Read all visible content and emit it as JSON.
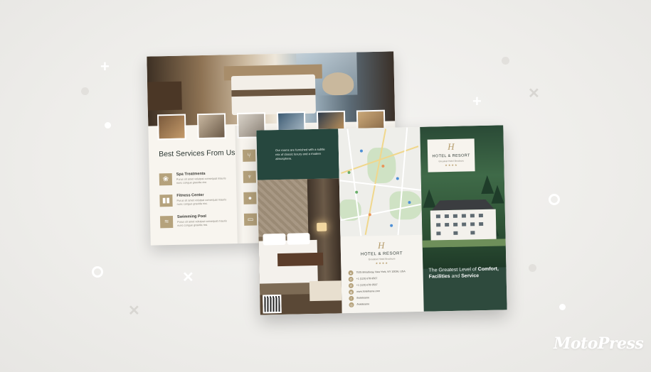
{
  "back_brochure": {
    "heading": "Best Services From Us",
    "services": [
      {
        "name": "Spa Treatments",
        "desc": "Purus sit amet volutpat consequat mauris nunc congue gravida nisi.",
        "icon": "spa-icon"
      },
      {
        "name": "Fitness Center",
        "desc": "Purus sit amet volutpat consequat mauris nunc congue gravida nisi.",
        "icon": "dumbbell-icon"
      },
      {
        "name": "Swimming Pool",
        "desc": "Purus sit amet volutpat consequat mauris nunc congue gravida nisi.",
        "icon": "swimmer-icon"
      }
    ],
    "middle_icons": [
      "restaurant-icon",
      "bar-icon",
      "microphone-icon",
      "tv-icon"
    ]
  },
  "front_brochure": {
    "intro_text": "Our rooms are furnished with a subtle mix of classic luxury and a modern atmosphere.",
    "map_logo": {
      "name": "HOTEL & RESORT",
      "sub": "Greatest Hotel Brochure",
      "stars": "★★★★"
    },
    "contacts": [
      {
        "icon": "location-icon",
        "text": "7535 Broadway, New York, NY 10036, USA"
      },
      {
        "icon": "phone-icon",
        "text": "+1 (123) 678-9567"
      },
      {
        "icon": "phone-icon",
        "text": "+1 (123) 678-9567"
      },
      {
        "icon": "globe-icon",
        "text": "www.hotelname.com"
      },
      {
        "icon": "facebook-icon",
        "text": "/hotelname"
      },
      {
        "icon": "instagram-icon",
        "text": "/hotelname"
      }
    ],
    "cover_logo": {
      "name": "HOTEL & RESORT",
      "sub": "Greatest Hotel Brochure",
      "stars": "★★★★"
    },
    "tagline_prefix": "The Greatest Level of ",
    "tagline_bold1": "Comfort, Facilities",
    "tagline_mid": " and ",
    "tagline_bold2": "Service"
  },
  "brand": "MotoPress",
  "colors": {
    "accent_gold": "#b5a27c",
    "brand_green": "#26473e",
    "background": "#efeeeb"
  }
}
